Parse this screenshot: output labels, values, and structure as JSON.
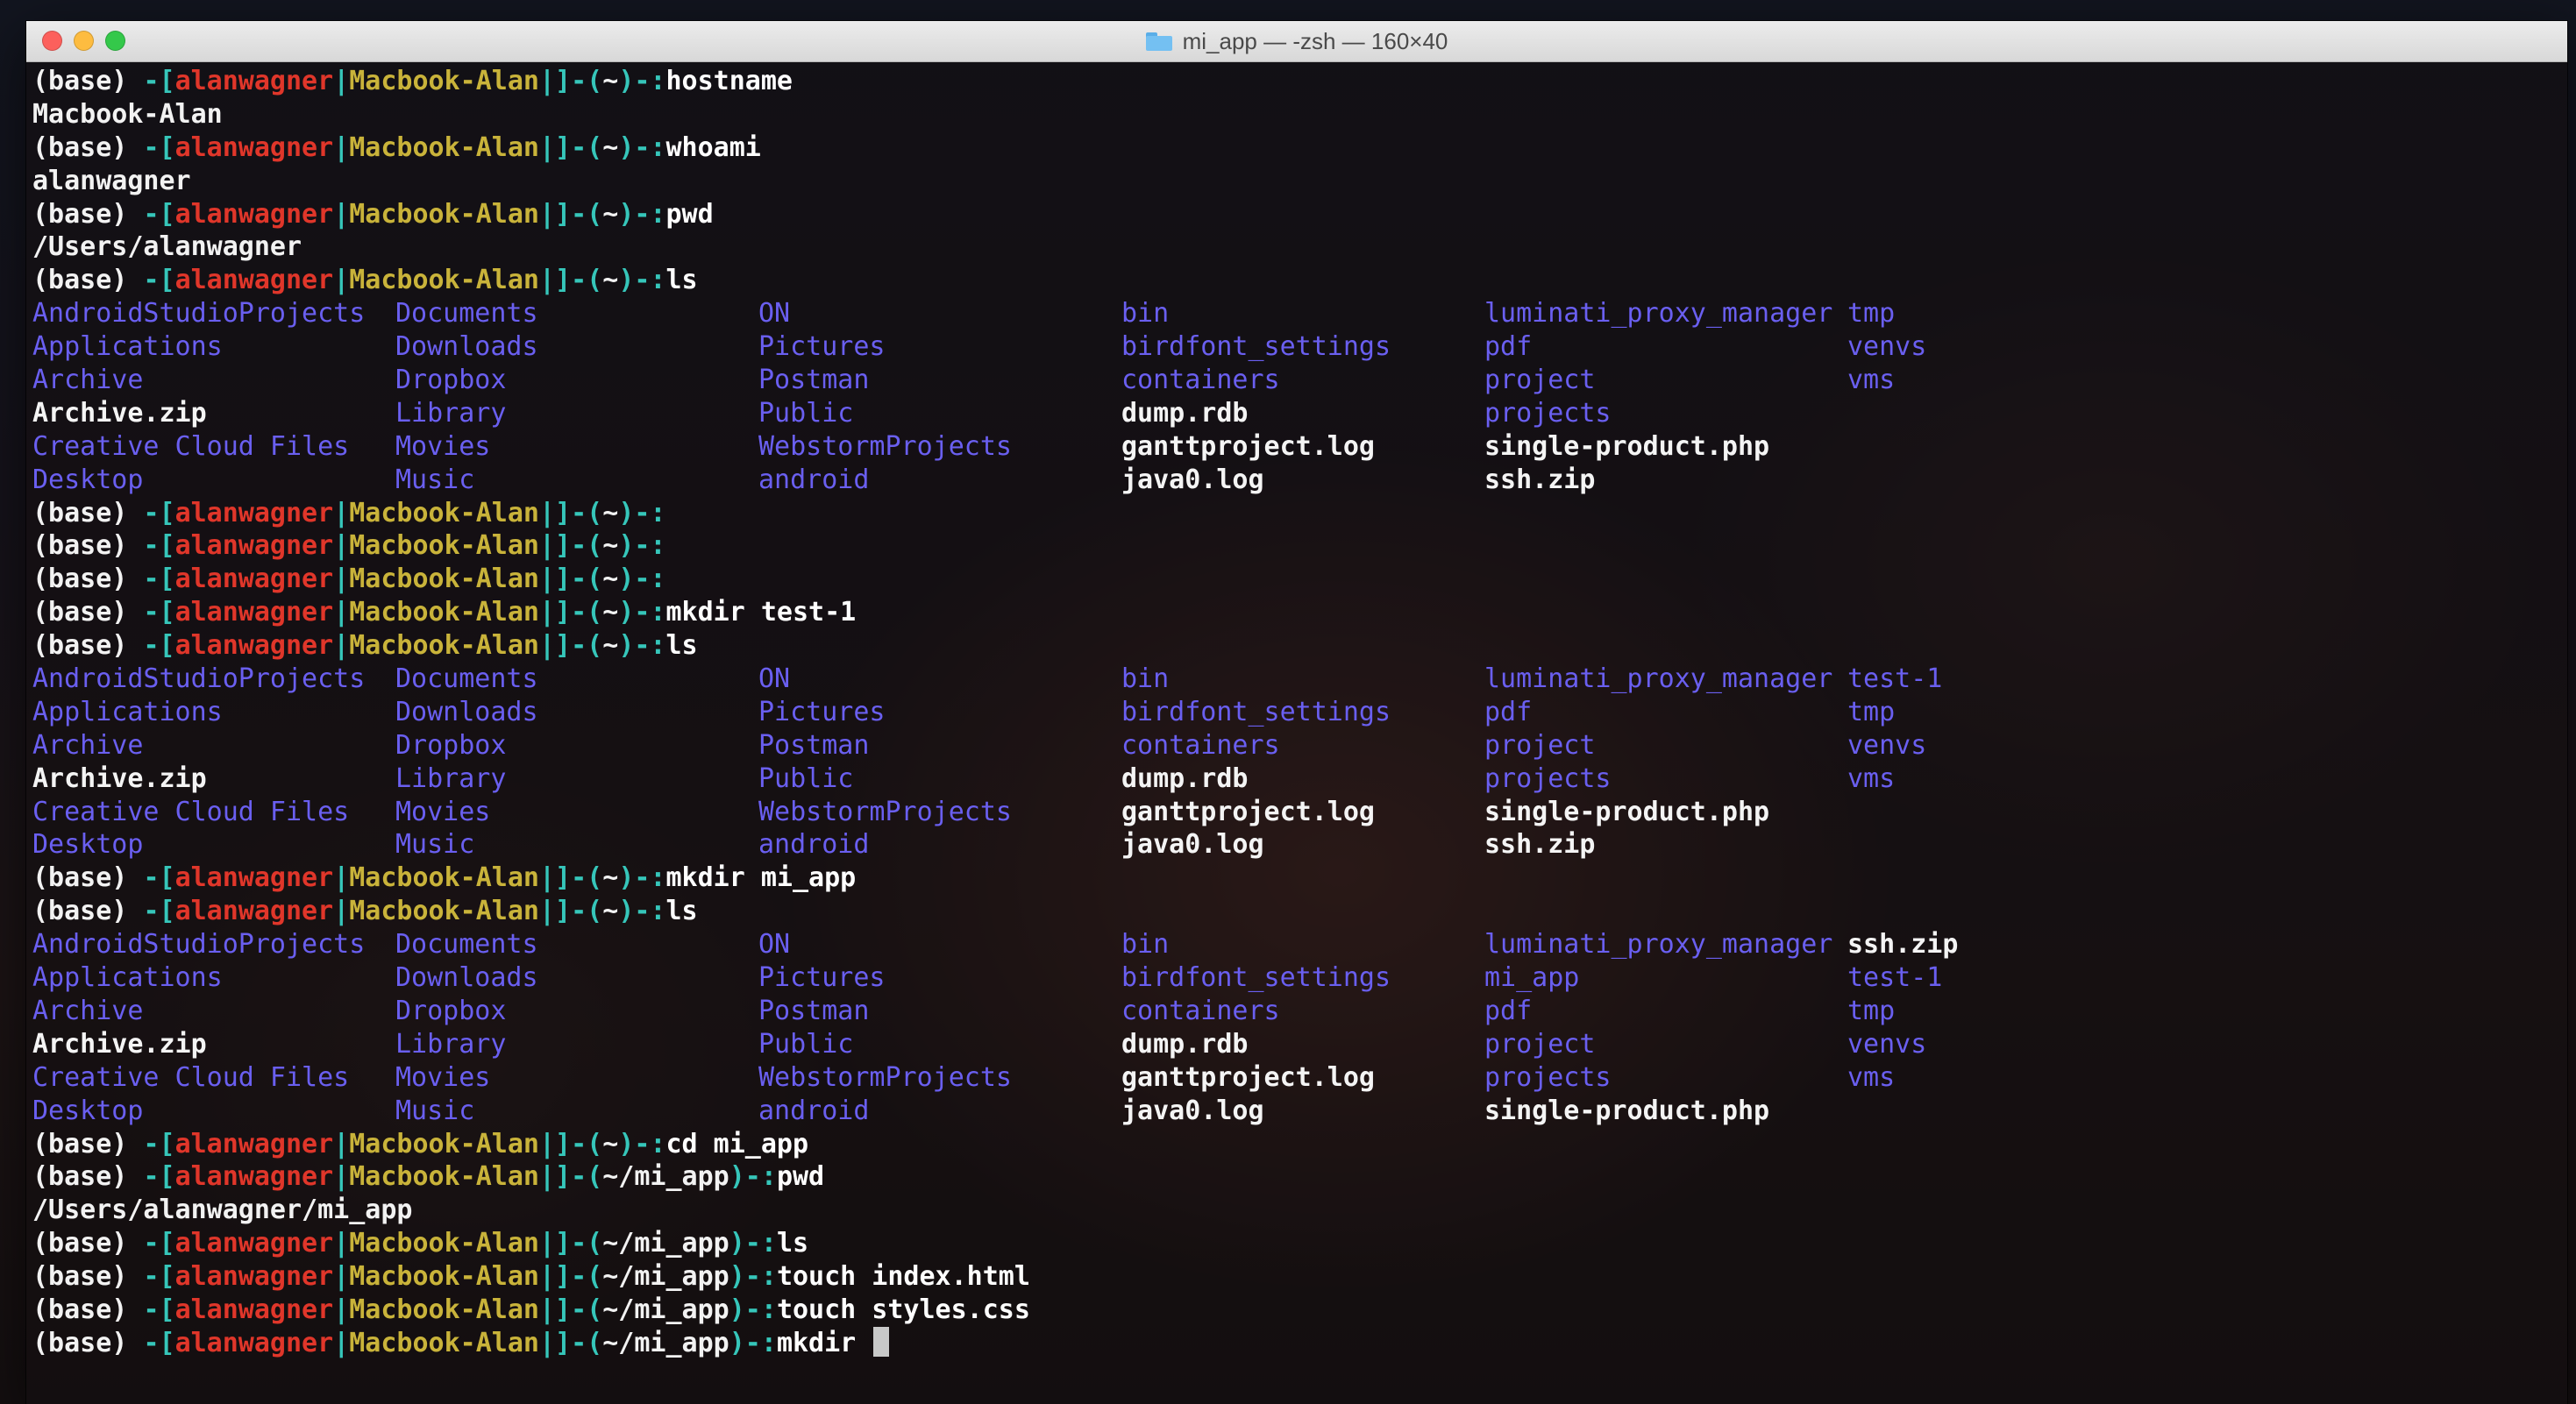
{
  "window": {
    "title": "mi_app — -zsh — 160×40",
    "folder_icon": "folder-icon"
  },
  "colors": {
    "bracket": "#36c6ba",
    "user": "#e0362a",
    "host": "#c9b33a",
    "directory": "#6a5ff0",
    "file": "#f4f4f4"
  },
  "prompt": {
    "env": "(base) ",
    "open": "-[",
    "user": "alanwagner",
    "sep": "|",
    "host": "Macbook-Alan",
    "mid": "|]-(",
    "close_suffix": ")-:"
  },
  "lines": [
    {
      "type": "prompt",
      "path": "~",
      "cmd": "hostname"
    },
    {
      "type": "output",
      "text": "Macbook-Alan"
    },
    {
      "type": "prompt",
      "path": "~",
      "cmd": "whoami"
    },
    {
      "type": "output",
      "text": "alanwagner"
    },
    {
      "type": "prompt",
      "path": "~",
      "cmd": "pwd"
    },
    {
      "type": "output",
      "text": "/Users/alanwagner"
    },
    {
      "type": "prompt",
      "path": "~",
      "cmd": "ls"
    },
    {
      "type": "ls",
      "rows": [
        [
          {
            "t": "AndroidStudioProjects",
            "d": true
          },
          {
            "t": "Documents",
            "d": true
          },
          {
            "t": "ON",
            "d": true
          },
          {
            "t": "bin",
            "d": true
          },
          {
            "t": "luminati_proxy_manager",
            "d": true
          },
          {
            "t": "tmp",
            "d": true
          }
        ],
        [
          {
            "t": "Applications",
            "d": true
          },
          {
            "t": "Downloads",
            "d": true
          },
          {
            "t": "Pictures",
            "d": true
          },
          {
            "t": "birdfont_settings",
            "d": true
          },
          {
            "t": "pdf",
            "d": true
          },
          {
            "t": "venvs",
            "d": true
          }
        ],
        [
          {
            "t": "Archive",
            "d": true
          },
          {
            "t": "Dropbox",
            "d": true
          },
          {
            "t": "Postman",
            "d": true
          },
          {
            "t": "containers",
            "d": true
          },
          {
            "t": "project",
            "d": true
          },
          {
            "t": "vms",
            "d": true
          }
        ],
        [
          {
            "t": "Archive.zip",
            "d": false
          },
          {
            "t": "Library",
            "d": true
          },
          {
            "t": "Public",
            "d": true
          },
          {
            "t": "dump.rdb",
            "d": false
          },
          {
            "t": "projects",
            "d": true
          },
          {
            "t": "",
            "d": false
          }
        ],
        [
          {
            "t": "Creative Cloud Files",
            "d": true
          },
          {
            "t": "Movies",
            "d": true
          },
          {
            "t": "WebstormProjects",
            "d": true
          },
          {
            "t": "ganttproject.log",
            "d": false
          },
          {
            "t": "single-product.php",
            "d": false
          },
          {
            "t": "",
            "d": false
          }
        ],
        [
          {
            "t": "Desktop",
            "d": true
          },
          {
            "t": "Music",
            "d": true
          },
          {
            "t": "android",
            "d": true
          },
          {
            "t": "java0.log",
            "d": false
          },
          {
            "t": "ssh.zip",
            "d": false
          },
          {
            "t": "",
            "d": false
          }
        ]
      ]
    },
    {
      "type": "prompt",
      "path": "~",
      "cmd": ""
    },
    {
      "type": "prompt",
      "path": "~",
      "cmd": ""
    },
    {
      "type": "prompt",
      "path": "~",
      "cmd": ""
    },
    {
      "type": "prompt",
      "path": "~",
      "cmd": "mkdir test-1"
    },
    {
      "type": "prompt",
      "path": "~",
      "cmd": "ls"
    },
    {
      "type": "ls",
      "rows": [
        [
          {
            "t": "AndroidStudioProjects",
            "d": true
          },
          {
            "t": "Documents",
            "d": true
          },
          {
            "t": "ON",
            "d": true
          },
          {
            "t": "bin",
            "d": true
          },
          {
            "t": "luminati_proxy_manager",
            "d": true
          },
          {
            "t": "test-1",
            "d": true
          }
        ],
        [
          {
            "t": "Applications",
            "d": true
          },
          {
            "t": "Downloads",
            "d": true
          },
          {
            "t": "Pictures",
            "d": true
          },
          {
            "t": "birdfont_settings",
            "d": true
          },
          {
            "t": "pdf",
            "d": true
          },
          {
            "t": "tmp",
            "d": true
          }
        ],
        [
          {
            "t": "Archive",
            "d": true
          },
          {
            "t": "Dropbox",
            "d": true
          },
          {
            "t": "Postman",
            "d": true
          },
          {
            "t": "containers",
            "d": true
          },
          {
            "t": "project",
            "d": true
          },
          {
            "t": "venvs",
            "d": true
          }
        ],
        [
          {
            "t": "Archive.zip",
            "d": false
          },
          {
            "t": "Library",
            "d": true
          },
          {
            "t": "Public",
            "d": true
          },
          {
            "t": "dump.rdb",
            "d": false
          },
          {
            "t": "projects",
            "d": true
          },
          {
            "t": "vms",
            "d": true
          }
        ],
        [
          {
            "t": "Creative Cloud Files",
            "d": true
          },
          {
            "t": "Movies",
            "d": true
          },
          {
            "t": "WebstormProjects",
            "d": true
          },
          {
            "t": "ganttproject.log",
            "d": false
          },
          {
            "t": "single-product.php",
            "d": false
          },
          {
            "t": "",
            "d": false
          }
        ],
        [
          {
            "t": "Desktop",
            "d": true
          },
          {
            "t": "Music",
            "d": true
          },
          {
            "t": "android",
            "d": true
          },
          {
            "t": "java0.log",
            "d": false
          },
          {
            "t": "ssh.zip",
            "d": false
          },
          {
            "t": "",
            "d": false
          }
        ]
      ]
    },
    {
      "type": "prompt",
      "path": "~",
      "cmd": "mkdir mi_app"
    },
    {
      "type": "prompt",
      "path": "~",
      "cmd": "ls"
    },
    {
      "type": "ls",
      "rows": [
        [
          {
            "t": "AndroidStudioProjects",
            "d": true
          },
          {
            "t": "Documents",
            "d": true
          },
          {
            "t": "ON",
            "d": true
          },
          {
            "t": "bin",
            "d": true
          },
          {
            "t": "luminati_proxy_manager",
            "d": true
          },
          {
            "t": "ssh.zip",
            "d": false
          }
        ],
        [
          {
            "t": "Applications",
            "d": true
          },
          {
            "t": "Downloads",
            "d": true
          },
          {
            "t": "Pictures",
            "d": true
          },
          {
            "t": "birdfont_settings",
            "d": true
          },
          {
            "t": "mi_app",
            "d": true
          },
          {
            "t": "test-1",
            "d": true
          }
        ],
        [
          {
            "t": "Archive",
            "d": true
          },
          {
            "t": "Dropbox",
            "d": true
          },
          {
            "t": "Postman",
            "d": true
          },
          {
            "t": "containers",
            "d": true
          },
          {
            "t": "pdf",
            "d": true
          },
          {
            "t": "tmp",
            "d": true
          }
        ],
        [
          {
            "t": "Archive.zip",
            "d": false
          },
          {
            "t": "Library",
            "d": true
          },
          {
            "t": "Public",
            "d": true
          },
          {
            "t": "dump.rdb",
            "d": false
          },
          {
            "t": "project",
            "d": true
          },
          {
            "t": "venvs",
            "d": true
          }
        ],
        [
          {
            "t": "Creative Cloud Files",
            "d": true
          },
          {
            "t": "Movies",
            "d": true
          },
          {
            "t": "WebstormProjects",
            "d": true
          },
          {
            "t": "ganttproject.log",
            "d": false
          },
          {
            "t": "projects",
            "d": true
          },
          {
            "t": "vms",
            "d": true
          }
        ],
        [
          {
            "t": "Desktop",
            "d": true
          },
          {
            "t": "Music",
            "d": true
          },
          {
            "t": "android",
            "d": true
          },
          {
            "t": "java0.log",
            "d": false
          },
          {
            "t": "single-product.php",
            "d": false
          },
          {
            "t": "",
            "d": false
          }
        ]
      ]
    },
    {
      "type": "prompt",
      "path": "~",
      "cmd": "cd mi_app"
    },
    {
      "type": "prompt",
      "path": "~/mi_app",
      "cmd": "pwd"
    },
    {
      "type": "output",
      "text": "/Users/alanwagner/mi_app"
    },
    {
      "type": "prompt",
      "path": "~/mi_app",
      "cmd": "ls"
    },
    {
      "type": "prompt",
      "path": "~/mi_app",
      "cmd": "touch index.html"
    },
    {
      "type": "prompt",
      "path": "~/mi_app",
      "cmd": "touch styles.css"
    },
    {
      "type": "prompt",
      "path": "~/mi_app",
      "cmd": "mkdir ",
      "cursor": true
    }
  ]
}
